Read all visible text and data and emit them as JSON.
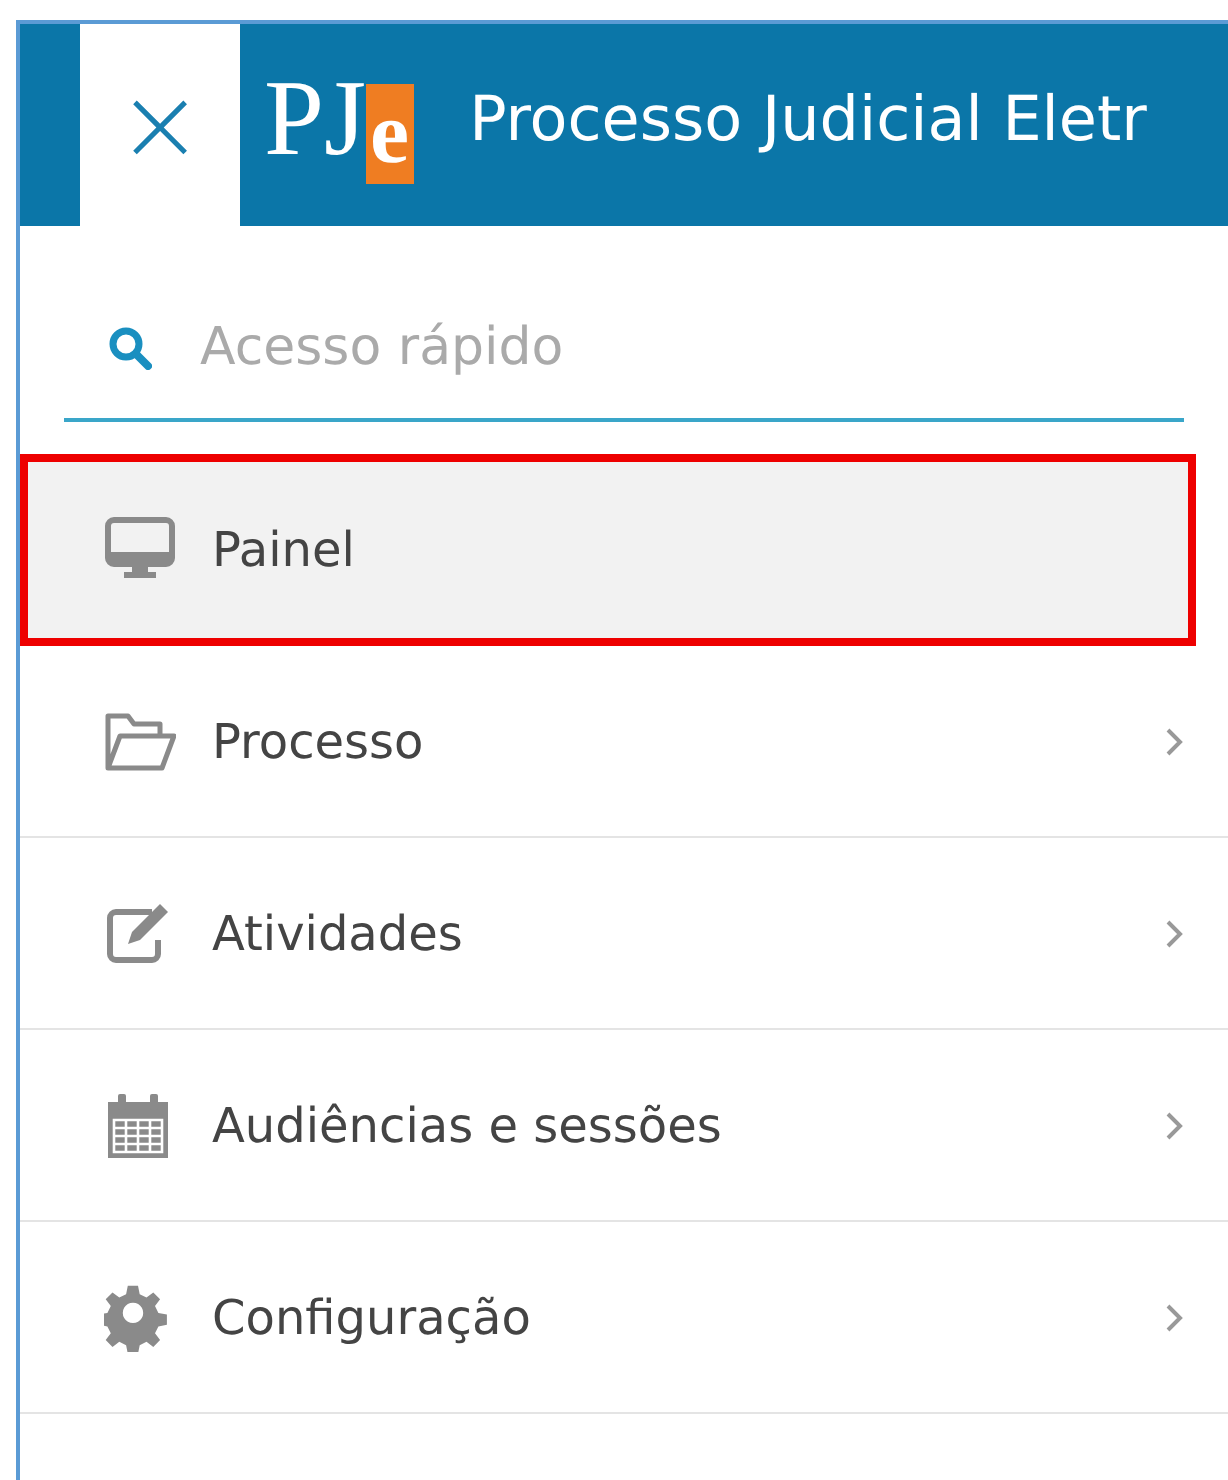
{
  "header": {
    "close_label": "×",
    "logo": {
      "text": "PJ",
      "accent": "e"
    },
    "title": "Processo Judicial Eletr"
  },
  "search": {
    "placeholder": "Acesso rápido"
  },
  "menu": [
    {
      "label": "Painel",
      "selected": true,
      "highlighted": true,
      "has_children": false
    },
    {
      "label": "Processo",
      "selected": false,
      "highlighted": false,
      "has_children": true
    },
    {
      "label": "Atividades",
      "selected": false,
      "highlighted": false,
      "has_children": true
    },
    {
      "label": "Audiências e sessões",
      "selected": false,
      "highlighted": false,
      "has_children": true
    },
    {
      "label": "Configuração",
      "selected": false,
      "highlighted": false,
      "has_children": true
    }
  ]
}
